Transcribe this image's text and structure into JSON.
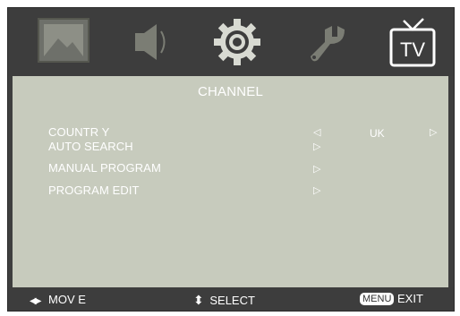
{
  "tabs": [
    {
      "icon": "picture-icon",
      "active": false
    },
    {
      "icon": "speaker-icon",
      "active": false
    },
    {
      "icon": "gear-icon",
      "active": false
    },
    {
      "icon": "wrench-icon",
      "active": false
    },
    {
      "icon": "tv-icon",
      "label": "TV",
      "active": true
    }
  ],
  "menu": {
    "title": "CHANNEL",
    "items": [
      {
        "label": "COUNTR Y",
        "value": "UK",
        "left_arrow": "◁",
        "right_arrow": "▷"
      },
      {
        "label": "AUTO SEARCH",
        "right_arrow": "▷"
      },
      {
        "label": "MANUAL  PROGRAM",
        "right_arrow": "▷"
      },
      {
        "label": "PROGRAM  EDIT",
        "right_arrow": "▷"
      }
    ]
  },
  "footer": {
    "move_icon": "◀▶",
    "move_label": "MOV E",
    "select_icon": "⬍",
    "select_label": "SELECT",
    "menu_key": "MENU",
    "exit_label": "EXIT"
  },
  "colors": {
    "panel": "#c7cbbd",
    "bar": "#3d3d3d",
    "active_icon": "#ffffff",
    "inactive_icon": "#7b7d74"
  }
}
